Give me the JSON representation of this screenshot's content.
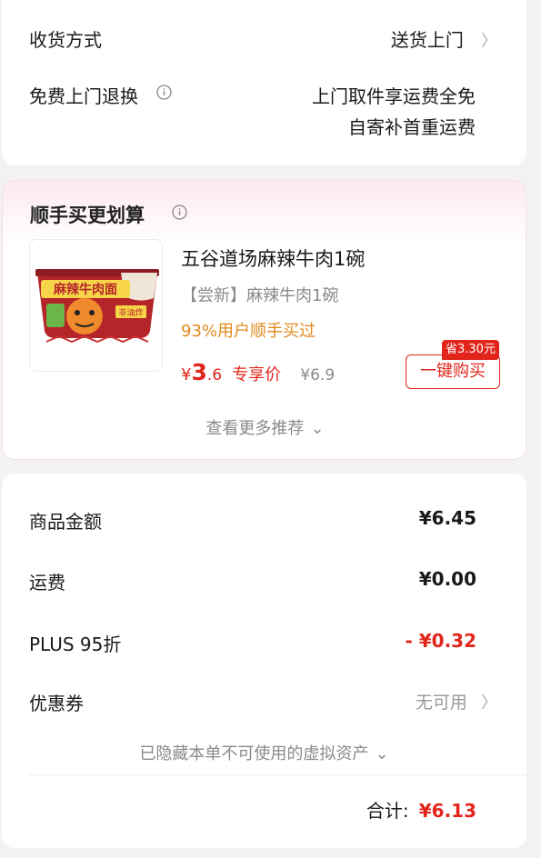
{
  "delivery": {
    "method_label": "收货方式",
    "method_value": "送货上门",
    "return_label": "免费上门退换",
    "return_line1": "上门取件享运费全免",
    "return_line2": "自寄补首重运费"
  },
  "addon": {
    "title": "顺手买更划算",
    "product": {
      "name": "五谷道场麻辣牛肉1碗",
      "tag": "【尝新】麻辣牛肉1碗",
      "bought": "93%用户顺手买过",
      "price_symbol": "¥",
      "price_int": "3",
      "price_dec": ".6",
      "price_tag": "专享价",
      "original_price": "¥6.9",
      "save_badge": "省3.30元",
      "buy_label": "一键购买",
      "package_text_1": "麻辣牛肉面",
      "package_text_2": "非油炸"
    },
    "more_label": "查看更多推荐"
  },
  "summary": {
    "rows": [
      {
        "label": "商品金额",
        "value": "¥6.45"
      },
      {
        "label": "运费",
        "value": "¥0.00"
      },
      {
        "label": "PLUS 95折",
        "value": "- ¥0.32"
      },
      {
        "label": "优惠券",
        "value": "无可用"
      }
    ],
    "hidden_note": "已隐藏本单不可使用的虚拟资产",
    "total_label": "合计:",
    "total_value": "¥6.13"
  },
  "colors": {
    "accent_red": "#e1251b",
    "orange": "#e08a1e",
    "muted_gray": "#8a8a8a"
  }
}
